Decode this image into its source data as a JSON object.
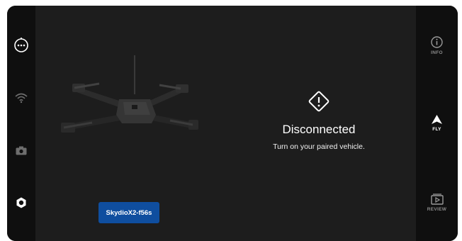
{
  "status": {
    "title": "Disconnected",
    "message": "Turn on your paired vehicle.",
    "icon": "warning-diamond-icon"
  },
  "vehicle": {
    "name": "SkydioX2-f56s"
  },
  "left_rail": {
    "items": [
      {
        "icon": "more-options-icon"
      },
      {
        "icon": "wifi-icon"
      },
      {
        "icon": "camera-icon"
      },
      {
        "icon": "settings-gear-icon"
      }
    ]
  },
  "right_rail": {
    "info_label": "INFO",
    "fly_label": "FLY",
    "review_label": "REVIEW"
  },
  "colors": {
    "screen_bg": "#1d1d1d",
    "rail_bg": "#0f0f0f",
    "accent_blue": "#0f4e9f",
    "active_white": "#ffffff",
    "inactive_gray": "#8b8b8b"
  }
}
